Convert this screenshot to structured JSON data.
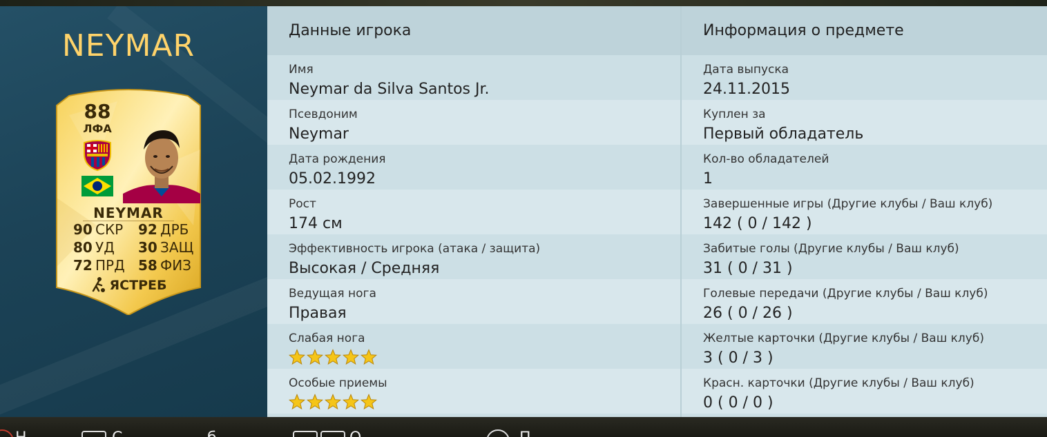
{
  "player_name_title": "NEYMAR",
  "card": {
    "rating": "88",
    "position": "ЛФА",
    "name": "NEYMAR",
    "stats": [
      {
        "value": "90",
        "label": "СКР"
      },
      {
        "value": "92",
        "label": "ДРБ"
      },
      {
        "value": "80",
        "label": "УД"
      },
      {
        "value": "30",
        "label": "ЗАЩ"
      },
      {
        "value": "72",
        "label": "ПРД"
      },
      {
        "value": "58",
        "label": "ФИЗ"
      }
    ],
    "chemistry_style": "ЯСТРЕБ",
    "colors": {
      "gold_light": "#fff1b8",
      "gold_mid": "#f3c94e",
      "gold_dark": "#d9a520",
      "text": "#3a2a08"
    }
  },
  "left_column": {
    "header": "Данные игрока",
    "rows": [
      {
        "label": "Имя",
        "value": "Neymar da Silva Santos Jr."
      },
      {
        "label": "Псевдоним",
        "value": "Neymar"
      },
      {
        "label": "Дата рождения",
        "value": "05.02.1992"
      },
      {
        "label": "Рост",
        "value": "174 см"
      },
      {
        "label": "Эффективность игрока (атака / защита)",
        "value": "Высокая / Средняя"
      },
      {
        "label": "Ведущая нога",
        "value": "Правая"
      },
      {
        "label": "Слабая нога",
        "stars": 5
      },
      {
        "label": "Особые приемы",
        "stars": 5
      }
    ]
  },
  "right_column": {
    "header": "Информация о предмете",
    "rows": [
      {
        "label": "Дата выпуска",
        "value": "24.11.2015"
      },
      {
        "label": "Куплен за",
        "value": "Первый обладатель"
      },
      {
        "label": "Кол-во обладателей",
        "value": "1"
      },
      {
        "label": "Завершенные игры (Другие клубы / Ваш клуб)",
        "value": "142 ( 0 / 142 )"
      },
      {
        "label": "Забитые голы (Другие клубы / Ваш клуб)",
        "value": "31 ( 0 / 31 )"
      },
      {
        "label": "Голевые передачи (Другие клубы / Ваш клуб)",
        "value": "26 ( 0 / 26 )"
      },
      {
        "label": "Желтые карточки (Другие клубы / Ваш клуб)",
        "value": "3 ( 0 / 3 )"
      },
      {
        "label": "Красн. карточки (Другие клубы / Ваш клуб)",
        "value": "0 ( 0 / 0 )"
      }
    ]
  },
  "bottom_hints": [
    "Н",
    "С",
    "б",
    "О",
    "П"
  ],
  "colors": {
    "left_panel": "#1c4357",
    "title_gold": "#ffd36a",
    "row_base": "#ccdfe5",
    "row_alt": "#d8e7ec",
    "header_bg": "#bed3da",
    "star_color": "#f5c518"
  }
}
